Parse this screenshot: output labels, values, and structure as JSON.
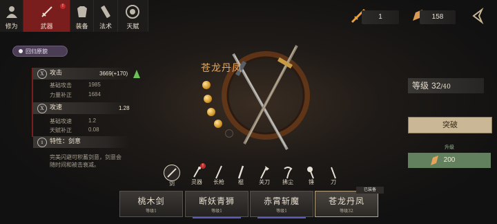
{
  "nav": {
    "tabs": [
      {
        "label": "修为",
        "icon": "cultivator-icon"
      },
      {
        "label": "武器",
        "icon": "sword-icon",
        "badge": "!"
      },
      {
        "label": "装备",
        "icon": "armor-icon"
      },
      {
        "label": "法术",
        "icon": "spell-scroll-icon"
      },
      {
        "label": "天赋",
        "icon": "talent-icon"
      }
    ]
  },
  "resources": {
    "material1": {
      "icon": "forge-material-icon",
      "value": "1"
    },
    "material2": {
      "icon": "crystal-icon",
      "value": "158"
    }
  },
  "left": {
    "tag_button": "回归原貌",
    "attack": {
      "label": "攻击",
      "value": "3669(+170)",
      "icon_char": "X",
      "subs": [
        {
          "label": "基础攻击",
          "value": "1985"
        },
        {
          "label": "力量补正",
          "value": "1684"
        }
      ]
    },
    "speed": {
      "label": "攻速",
      "value": "1.28",
      "icon_char": "X",
      "subs": [
        {
          "label": "基础攻速",
          "value": "1.2"
        },
        {
          "label": "天赋补正",
          "value": "0.08"
        }
      ]
    },
    "trait": {
      "label": "特性：剑意",
      "desc": "完美闪避可积蓄剑意，剑意会随时间和被击衰减。"
    }
  },
  "center": {
    "weapon_name": "苍龙丹凤",
    "orbs_filled": 4,
    "orbs_total": 5
  },
  "right": {
    "level_label": "等级",
    "level": "32",
    "level_max": "/40",
    "break_label": "突破",
    "upgrade_label": "升级",
    "upgrade_cost": "200"
  },
  "weapon_types": [
    {
      "label": "剑",
      "icon": "sword-icon",
      "selected": true
    },
    {
      "label": "刀",
      "icon": "dagger-icon"
    },
    {
      "label": "长枪",
      "icon": "spear-icon"
    },
    {
      "label": "棍",
      "icon": "staff-icon"
    },
    {
      "label": "刀",
      "icon": "broadsword-icon"
    },
    {
      "label": "拂尘",
      "icon": "whisk-icon"
    },
    {
      "label": "锤",
      "icon": "hammer-icon"
    },
    {
      "label": "刀",
      "icon": "polearm-icon"
    }
  ],
  "weapon_type_labels_display": [
    "剑",
    "灵器",
    "长枪",
    "棍",
    "关刀",
    "拂尘",
    "锤",
    "刀"
  ],
  "cards": [
    {
      "name": "桃木剑",
      "level": "等级1"
    },
    {
      "name": "断妖青狮",
      "level": "等级1"
    },
    {
      "name": "赤霄斩魔",
      "level": "等级1"
    },
    {
      "name": "苍龙丹凤",
      "level": "等级32",
      "equipped": "已装备"
    }
  ],
  "colors": {
    "accent_red": "#7a1d1d",
    "gold": "#e9a85a",
    "upgrade_green": "#62805e"
  }
}
